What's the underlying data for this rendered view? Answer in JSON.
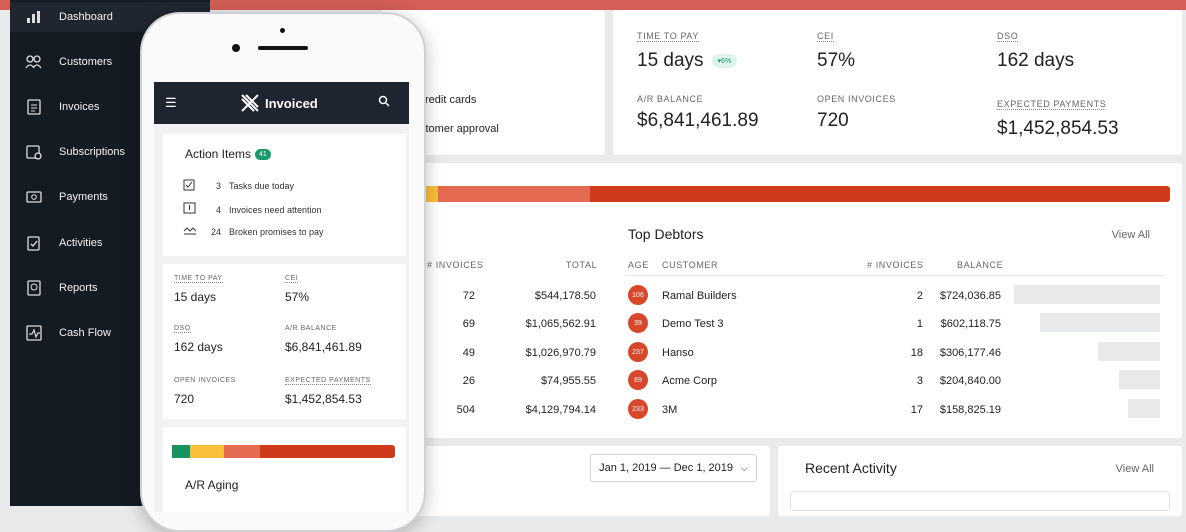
{
  "colors": {
    "accent": "#d35f56",
    "sidebar": "#151b23",
    "green": "#1a9a6b",
    "aging": [
      "#17945f",
      "#fbbf3a",
      "#e46b52",
      "#cf3a1b"
    ]
  },
  "sidebar": {
    "items": [
      {
        "label": "Dashboard",
        "icon": "chart-icon"
      },
      {
        "label": "Customers",
        "icon": "users-icon"
      },
      {
        "label": "Invoices",
        "icon": "invoice-icon"
      },
      {
        "label": "Subscriptions",
        "icon": "subscription-icon"
      },
      {
        "label": "Payments",
        "icon": "payment-icon"
      },
      {
        "label": "Activities",
        "icon": "activity-icon"
      },
      {
        "label": "Reports",
        "icon": "report-icon"
      },
      {
        "label": "Cash Flow",
        "icon": "cashflow-icon"
      }
    ]
  },
  "partial_text": {
    "line1": "redit cards",
    "line2": "stomer approval"
  },
  "metrics": {
    "time_to_pay": {
      "label": "TIME TO PAY",
      "value": "15 days",
      "delta": "▾6%"
    },
    "cei": {
      "label": "CEI",
      "value": "57%"
    },
    "dso": {
      "label": "DSO",
      "value": "162 days"
    },
    "ar_balance": {
      "label": "A/R BALANCE",
      "value": "$6,841,461.89"
    },
    "open_invoices": {
      "label": "OPEN INVOICES",
      "value": "720"
    },
    "expected_payments": {
      "label": "EXPECTED PAYMENTS",
      "value": "$1,452,854.53"
    }
  },
  "left_table": {
    "headers": {
      "invoices": "# INVOICES",
      "total": "TOTAL"
    },
    "rows": [
      {
        "invoices": "72",
        "total": "$544,178.50"
      },
      {
        "invoices": "69",
        "total": "$1,065,562.91"
      },
      {
        "invoices": "49",
        "total": "$1,026,970.79"
      },
      {
        "invoices": "26",
        "total": "$74,955.55"
      },
      {
        "invoices": "504",
        "total": "$4,129,794.14"
      }
    ]
  },
  "top_debtors": {
    "title": "Top Debtors",
    "view_all": "View All",
    "headers": {
      "age": "AGE",
      "customer": "CUSTOMER",
      "invoices": "# INVOICES",
      "balance": "BALANCE"
    },
    "rows": [
      {
        "age": "106",
        "customer": "Ramal Builders",
        "invoices": "2",
        "balance": "$724,036.85",
        "share": 0.2
      },
      {
        "age": "39",
        "customer": "Demo Test 3",
        "invoices": "1",
        "balance": "$602,118.75",
        "share": 0.165
      },
      {
        "age": "237",
        "customer": "Hanso",
        "invoices": "18",
        "balance": "$306,177.46",
        "share": 0.085
      },
      {
        "age": "69",
        "customer": "Acme Corp",
        "invoices": "3",
        "balance": "$204,840.00",
        "share": 0.056
      },
      {
        "age": "233",
        "customer": "3M",
        "invoices": "17",
        "balance": "$158,825.19",
        "share": 0.044
      }
    ]
  },
  "date_range": "Jan 1, 2019 — Dec 1, 2019",
  "recent_activity": {
    "title": "Recent Activity",
    "view_all": "View All"
  },
  "phone": {
    "brand": "Invoiced",
    "action_items": {
      "title": "Action Items",
      "count": "41",
      "items": [
        {
          "num": "3",
          "text": "Tasks due today",
          "icon": "checklist-icon"
        },
        {
          "num": "4",
          "text": "Invoices need attention",
          "icon": "attention-icon"
        },
        {
          "num": "24",
          "text": "Broken promises to pay",
          "icon": "broken-promise-icon"
        }
      ]
    },
    "metrics": {
      "time_to_pay": {
        "label": "TIME TO PAY",
        "value": "15 days"
      },
      "cei": {
        "label": "CEI",
        "value": "57%"
      },
      "dso": {
        "label": "DSO",
        "value": "162 days"
      },
      "ar_balance": {
        "label": "A/R BALANCE",
        "value": "$6,841,461.89"
      },
      "open_invoices": {
        "label": "OPEN INVOICES",
        "value": "720"
      },
      "expected_payments": {
        "label": "EXPECTED PAYMENTS",
        "value": "$1,452,854.53"
      }
    },
    "ar_aging_title": "A/R Aging"
  }
}
